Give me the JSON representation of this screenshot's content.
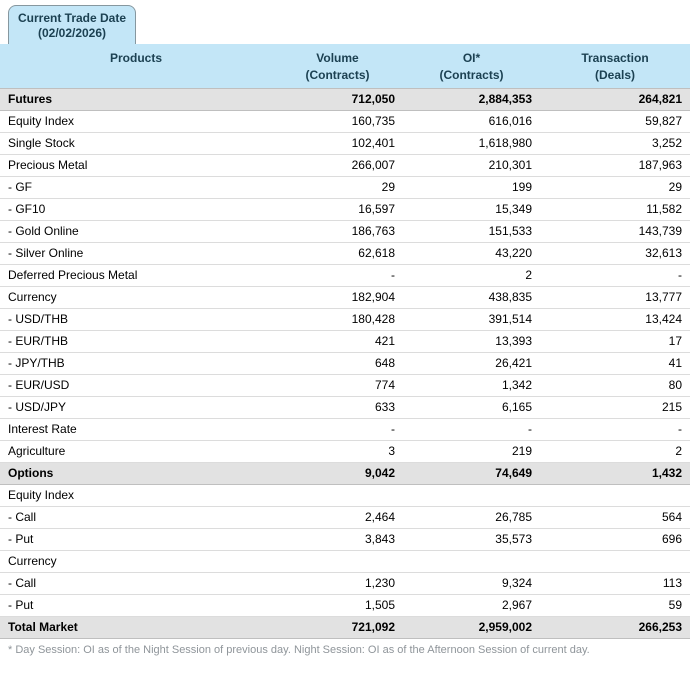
{
  "tab": {
    "line1": "Current Trade Date",
    "line2": "(02/02/2026)"
  },
  "table": {
    "columns": [
      {
        "label": "Products",
        "sub": ""
      },
      {
        "label": "Volume",
        "sub": "(Contracts)"
      },
      {
        "label": "OI*",
        "sub": "(Contracts)"
      },
      {
        "label": "Transaction",
        "sub": "(Deals)"
      }
    ],
    "rows": [
      {
        "product": "Futures",
        "volume": "712,050",
        "oi": "2,884,353",
        "transaction": "264,821",
        "style": "section"
      },
      {
        "product": "Equity Index",
        "volume": "160,735",
        "oi": "616,016",
        "transaction": "59,827",
        "style": "normal"
      },
      {
        "product": "Single Stock",
        "volume": "102,401",
        "oi": "1,618,980",
        "transaction": "3,252",
        "style": "normal"
      },
      {
        "product": "Precious Metal",
        "volume": "266,007",
        "oi": "210,301",
        "transaction": "187,963",
        "style": "normal"
      },
      {
        "product": "- GF",
        "volume": "29",
        "oi": "199",
        "transaction": "29",
        "style": "normal"
      },
      {
        "product": "- GF10",
        "volume": "16,597",
        "oi": "15,349",
        "transaction": "11,582",
        "style": "normal"
      },
      {
        "product": "- Gold Online",
        "volume": "186,763",
        "oi": "151,533",
        "transaction": "143,739",
        "style": "normal"
      },
      {
        "product": "- Silver Online",
        "volume": "62,618",
        "oi": "43,220",
        "transaction": "32,613",
        "style": "normal"
      },
      {
        "product": "Deferred Precious Metal",
        "volume": "-",
        "oi": "2",
        "transaction": "-",
        "style": "normal"
      },
      {
        "product": "Currency",
        "volume": "182,904",
        "oi": "438,835",
        "transaction": "13,777",
        "style": "normal"
      },
      {
        "product": "- USD/THB",
        "volume": "180,428",
        "oi": "391,514",
        "transaction": "13,424",
        "style": "normal"
      },
      {
        "product": "- EUR/THB",
        "volume": "421",
        "oi": "13,393",
        "transaction": "17",
        "style": "normal"
      },
      {
        "product": "- JPY/THB",
        "volume": "648",
        "oi": "26,421",
        "transaction": "41",
        "style": "normal"
      },
      {
        "product": "- EUR/USD",
        "volume": "774",
        "oi": "1,342",
        "transaction": "80",
        "style": "normal"
      },
      {
        "product": "- USD/JPY",
        "volume": "633",
        "oi": "6,165",
        "transaction": "215",
        "style": "normal"
      },
      {
        "product": "Interest Rate",
        "volume": "-",
        "oi": "-",
        "transaction": "-",
        "style": "normal"
      },
      {
        "product": "Agriculture",
        "volume": "3",
        "oi": "219",
        "transaction": "2",
        "style": "normal"
      },
      {
        "product": "Options",
        "volume": "9,042",
        "oi": "74,649",
        "transaction": "1,432",
        "style": "section"
      },
      {
        "product": "Equity Index",
        "volume": "",
        "oi": "",
        "transaction": "",
        "style": "normal"
      },
      {
        "product": "- Call",
        "volume": "2,464",
        "oi": "26,785",
        "transaction": "564",
        "style": "normal"
      },
      {
        "product": "- Put",
        "volume": "3,843",
        "oi": "35,573",
        "transaction": "696",
        "style": "normal"
      },
      {
        "product": "Currency",
        "volume": "",
        "oi": "",
        "transaction": "",
        "style": "normal"
      },
      {
        "product": "- Call",
        "volume": "1,230",
        "oi": "9,324",
        "transaction": "113",
        "style": "normal"
      },
      {
        "product": "- Put",
        "volume": "1,505",
        "oi": "2,967",
        "transaction": "59",
        "style": "normal"
      },
      {
        "product": "Total Market",
        "volume": "721,092",
        "oi": "2,959,002",
        "transaction": "266,253",
        "style": "section"
      }
    ]
  },
  "footnote": "* Day Session: OI as of the Night Session of previous day. Night Session: OI as of the Afternoon Session of current day.",
  "colors": {
    "header_bg": "#c3e6f7",
    "section_row_bg": "#e2e2e2",
    "header_text": "#1c4152",
    "footnote_text": "#8f959a"
  }
}
